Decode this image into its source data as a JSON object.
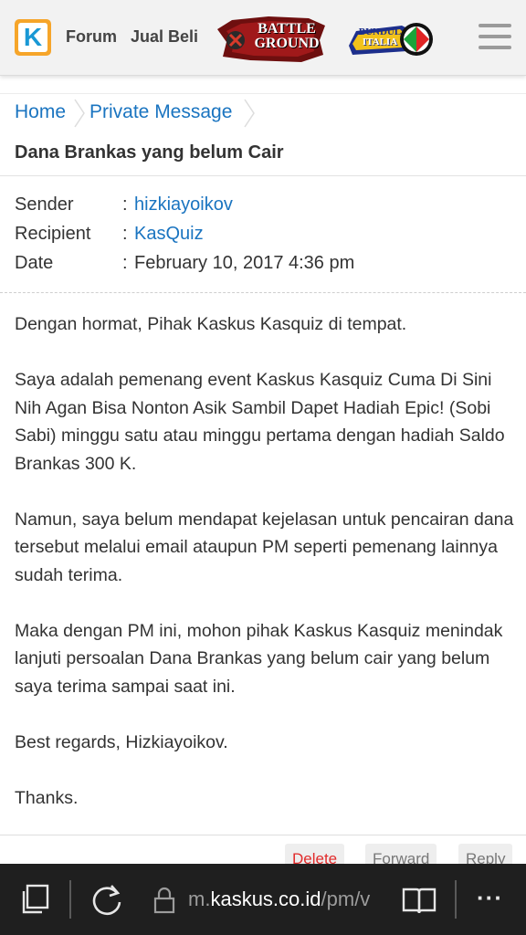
{
  "header": {
    "logo_letter": "K",
    "nav": [
      "Forum",
      "Jual Beli"
    ],
    "banner_battle": [
      "BATTLE",
      "GROUND"
    ],
    "banner_bundul": [
      "BUNDUL",
      "ITALIA"
    ]
  },
  "breadcrumb": [
    "Home",
    "Private Message"
  ],
  "title": "Dana Brankas yang belum Cair",
  "meta": {
    "sender_label": "Sender",
    "sender": "hizkiayoikov",
    "recipient_label": "Recipient",
    "recipient": "KasQuiz",
    "date_label": "Date",
    "date": "February 10, 2017 4:36 pm",
    "colon": ":"
  },
  "message": [
    "Dengan hormat, Pihak Kaskus Kasquiz di tempat.",
    "Saya adalah pemenang event Kaskus Kasquiz Cuma Di Sini Nih Agan Bisa Nonton Asik Sambil Dapet Hadiah Epic! (Sobi Sabi) minggu satu atau minggu pertama dengan hadiah Saldo Brankas 300 K.",
    "Namun, saya belum mendapat kejelasan untuk pencairan dana tersebut melalui email ataupun PM seperti pemenang lainnya sudah terima.",
    "Maka dengan PM ini, mohon pihak Kaskus Kasquiz menindak lanjuti persoalan Dana Brankas yang belum cair yang belum saya terima sampai saat ini.",
    "Best regards, Hizkiayoikov.",
    "Thanks."
  ],
  "actions": [
    "Delete",
    "Forward",
    "Reply"
  ],
  "browser": {
    "url_prefix": "m.",
    "url_host": "kaskus.co.id",
    "url_path": "/pm/v",
    "more": "···"
  },
  "colors": {
    "link": "#1a74c0",
    "logo_orange": "#f6a52a",
    "logo_blue": "#1998d5",
    "delete_red": "#e12b2b",
    "browser_bar": "#1f1f1f"
  },
  "icons": [
    "tabs-icon",
    "refresh-icon",
    "lock-icon",
    "reading-view-icon",
    "more-icon",
    "menu-icon"
  ]
}
